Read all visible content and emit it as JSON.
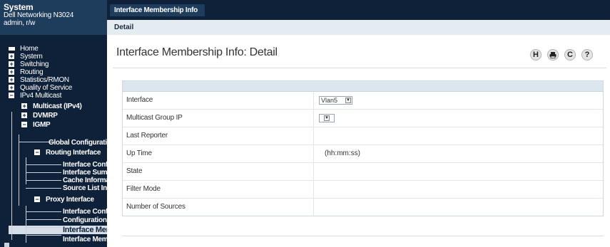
{
  "system": {
    "title": "System",
    "device": "Dell Networking N3024",
    "user": "admin, r/w"
  },
  "sidebar": {
    "items": [
      {
        "label": "Home",
        "icon": "home-icon"
      },
      {
        "label": "System",
        "toggle": "+"
      },
      {
        "label": "Switching",
        "toggle": "+"
      },
      {
        "label": "Routing",
        "toggle": "+"
      },
      {
        "label": "Statistics/RMON",
        "toggle": "+"
      },
      {
        "label": "Quality of Service",
        "toggle": "+"
      },
      {
        "label": "IPv4 Multicast",
        "toggle": "−"
      },
      {
        "label": "Multicast (IPv4)",
        "toggle": "+"
      },
      {
        "label": "DVMRP",
        "toggle": "+"
      },
      {
        "label": "IGMP",
        "toggle": "−"
      },
      {
        "label": "Global Configuratio"
      },
      {
        "label": "Routing Interface",
        "toggle": "−"
      },
      {
        "label": "Interface Config"
      },
      {
        "label": "Interface Summ"
      },
      {
        "label": "Cache Informa"
      },
      {
        "label": "Source List Info"
      },
      {
        "label": "Proxy Interface",
        "toggle": "−"
      },
      {
        "label": "Interface Config"
      },
      {
        "label": "Configuration S"
      },
      {
        "label": "Interface Mer"
      },
      {
        "label": "Interface Memb"
      }
    ]
  },
  "tabs": {
    "active": "Interface Membership Info",
    "sub": "Detail"
  },
  "page": {
    "title": "Interface Membership Info: Detail"
  },
  "toolbar": {
    "buttons": [
      {
        "glyph": "H",
        "icon": "help-h-icon"
      },
      {
        "glyph": "🖶",
        "icon": "print-icon"
      },
      {
        "glyph": "C",
        "icon": "refresh-icon"
      },
      {
        "glyph": "?",
        "icon": "question-icon"
      }
    ]
  },
  "table": {
    "rows": [
      {
        "label": "Interface",
        "value": "Vlan5",
        "type": "select"
      },
      {
        "label": "Multicast Group IP",
        "value": "",
        "type": "select"
      },
      {
        "label": "Last Reporter",
        "value": ""
      },
      {
        "label": "Up Time",
        "value": "(hh:mm:ss)"
      },
      {
        "label": "State",
        "value": ""
      },
      {
        "label": "Filter Mode",
        "value": ""
      },
      {
        "label": "Number of Sources",
        "value": ""
      }
    ]
  },
  "colors": {
    "nav_bg": "#0e2139",
    "header_bg": "#1e3c5c",
    "subnav_bg": "#e4ebf1",
    "table_head_bg": "#dbe6f0"
  }
}
